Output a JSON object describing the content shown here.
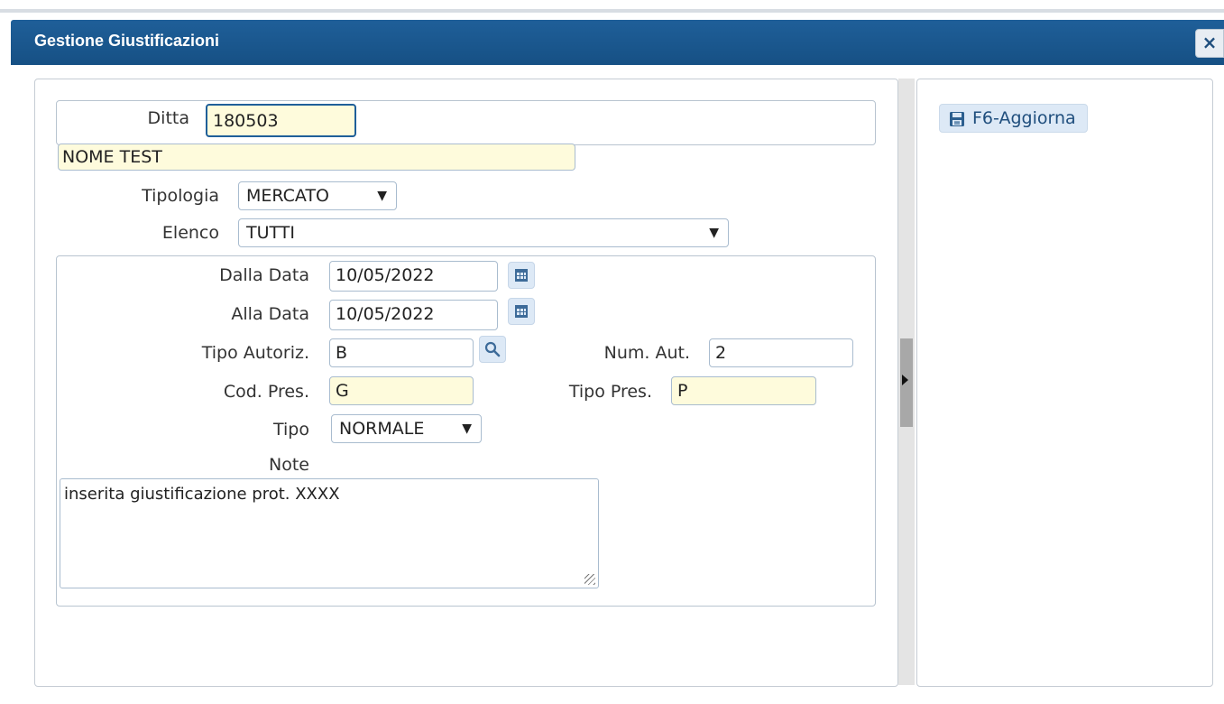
{
  "window": {
    "title": "Gestione Giustificazioni",
    "close_icon": "×"
  },
  "form": {
    "ditta": {
      "label": "Ditta",
      "value": "180503"
    },
    "nome": {
      "value": "NOME TEST"
    },
    "tipologia": {
      "label": "Tipologia",
      "value": "MERCATO"
    },
    "elenco": {
      "label": "Elenco",
      "value": "TUTTI"
    },
    "dalla_data": {
      "label": "Dalla Data",
      "value": "10/05/2022"
    },
    "alla_data": {
      "label": "Alla Data",
      "value": "10/05/2022"
    },
    "tipo_autoriz": {
      "label": "Tipo Autoriz.",
      "value": "B"
    },
    "num_aut": {
      "label": "Num. Aut.",
      "value": "2"
    },
    "cod_pres": {
      "label": "Cod. Pres.",
      "value": "G"
    },
    "tipo_pres": {
      "label": "Tipo Pres.",
      "value": "P"
    },
    "tipo": {
      "label": "Tipo",
      "value": "NORMALE"
    },
    "note": {
      "label": "Note",
      "value": "inserita giustificazione prot. XXXX"
    }
  },
  "toolbar": {
    "aggiorna_label": "F6-Aggiorna"
  },
  "icons": {
    "calendar": "calendar-icon",
    "search": "search-icon",
    "save": "save-icon",
    "chevron": "chevron-down-icon"
  },
  "colors": {
    "titlebar": "#1a5a91",
    "accent": "#1f5f99",
    "required_field": "#fefbdc"
  }
}
